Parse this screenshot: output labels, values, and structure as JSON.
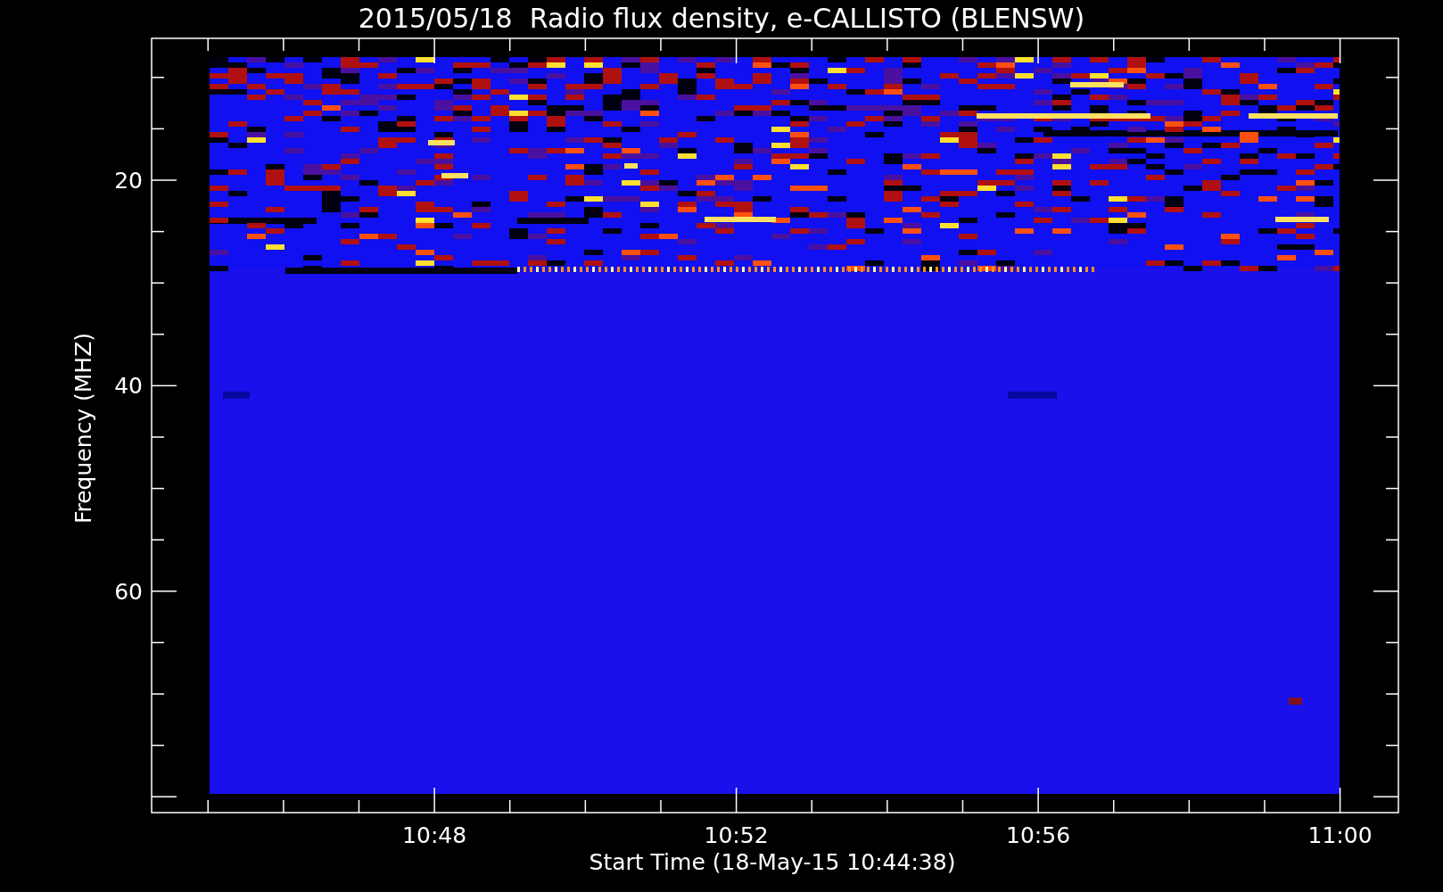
{
  "plot": {
    "title": "2015/05/18  Radio flux density, e-CALLISTO (BLENSW)",
    "ylabel": "Frequency (MHZ)",
    "yticks": [
      "20",
      "40",
      "60"
    ],
    "xticks": [
      "10:48",
      "10:52",
      "10:56",
      "11:00"
    ],
    "xlabel": "Start Time (18-May-15 10:44:38)"
  }
}
